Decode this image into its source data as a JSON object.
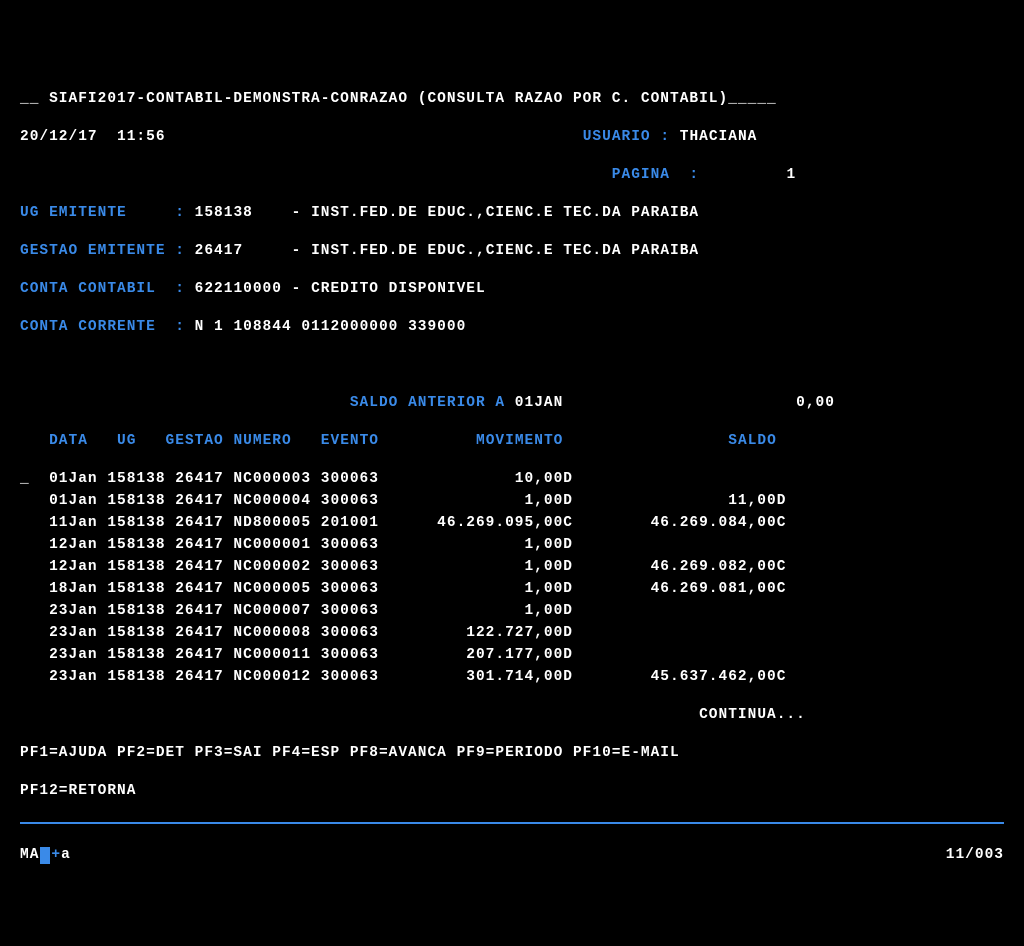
{
  "header": {
    "title_prefix": "__ ",
    "title": "SIAFI2017-CONTABIL-DEMONSTRA-CONRAZAO (CONSULTA RAZAO POR C. CONTABIL)",
    "title_suffix": "_____",
    "date": "20/12/17",
    "time": "11:56",
    "usuario_lbl": "USUARIO :",
    "usuario": "THACIANA",
    "pagina_lbl": "PAGINA  :",
    "pagina": "1"
  },
  "info": {
    "ug_lbl": "UG EMITENTE     :",
    "ug_val": "158138",
    "ug_desc": "- INST.FED.DE EDUC.,CIENC.E TEC.DA PARAIBA",
    "gestao_lbl": "GESTAO EMITENTE :",
    "gestao_val": "26417",
    "gestao_desc": "- INST.FED.DE EDUC.,CIENC.E TEC.DA PARAIBA",
    "conta_lbl": "CONTA CONTABIL  :",
    "conta_val": "622110000",
    "conta_desc": "- CREDITO DISPONIVEL",
    "corrente_lbl": "CONTA CORRENTE  :",
    "corrente_val": "N 1 108844 0112000000 339000"
  },
  "saldo_ant": {
    "label": "SALDO ANTERIOR A",
    "date": "01JAN",
    "value": "0,00"
  },
  "cols": {
    "data": "DATA",
    "ug": "UG",
    "gestao": "GESTAO",
    "numero": "NUMERO",
    "evento": "EVENTO",
    "movimento": "MOVIMENTO",
    "saldo": "SALDO"
  },
  "rows": [
    {
      "mark": "_",
      "data": "01Jan",
      "ug": "158138",
      "gestao": "26417",
      "numero": "NC000003",
      "evento": "300063",
      "mov": "10,00D",
      "saldo": ""
    },
    {
      "mark": " ",
      "data": "01Jan",
      "ug": "158138",
      "gestao": "26417",
      "numero": "NC000004",
      "evento": "300063",
      "mov": "1,00D",
      "saldo": "11,00D"
    },
    {
      "mark": " ",
      "data": "11Jan",
      "ug": "158138",
      "gestao": "26417",
      "numero": "ND800005",
      "evento": "201001",
      "mov": "46.269.095,00C",
      "saldo": "46.269.084,00C"
    },
    {
      "mark": " ",
      "data": "12Jan",
      "ug": "158138",
      "gestao": "26417",
      "numero": "NC000001",
      "evento": "300063",
      "mov": "1,00D",
      "saldo": ""
    },
    {
      "mark": " ",
      "data": "12Jan",
      "ug": "158138",
      "gestao": "26417",
      "numero": "NC000002",
      "evento": "300063",
      "mov": "1,00D",
      "saldo": "46.269.082,00C"
    },
    {
      "mark": " ",
      "data": "18Jan",
      "ug": "158138",
      "gestao": "26417",
      "numero": "NC000005",
      "evento": "300063",
      "mov": "1,00D",
      "saldo": "46.269.081,00C"
    },
    {
      "mark": " ",
      "data": "23Jan",
      "ug": "158138",
      "gestao": "26417",
      "numero": "NC000007",
      "evento": "300063",
      "mov": "1,00D",
      "saldo": ""
    },
    {
      "mark": " ",
      "data": "23Jan",
      "ug": "158138",
      "gestao": "26417",
      "numero": "NC000008",
      "evento": "300063",
      "mov": "122.727,00D",
      "saldo": ""
    },
    {
      "mark": " ",
      "data": "23Jan",
      "ug": "158138",
      "gestao": "26417",
      "numero": "NC000011",
      "evento": "300063",
      "mov": "207.177,00D",
      "saldo": ""
    },
    {
      "mark": " ",
      "data": "23Jan",
      "ug": "158138",
      "gestao": "26417",
      "numero": "NC000012",
      "evento": "300063",
      "mov": "301.714,00D",
      "saldo": "45.637.462,00C"
    }
  ],
  "continua": "CONTINUA...",
  "pfkeys_line1": "PF1=AJUDA PF2=DET PF3=SAI PF4=ESP PF8=AVANCA PF9=PERIODO PF10=E-MAIL",
  "pfkeys_line2": "PF12=RETORNA",
  "status": {
    "left": "MA",
    "plus": "+",
    "a": "a",
    "right": "11/003"
  }
}
